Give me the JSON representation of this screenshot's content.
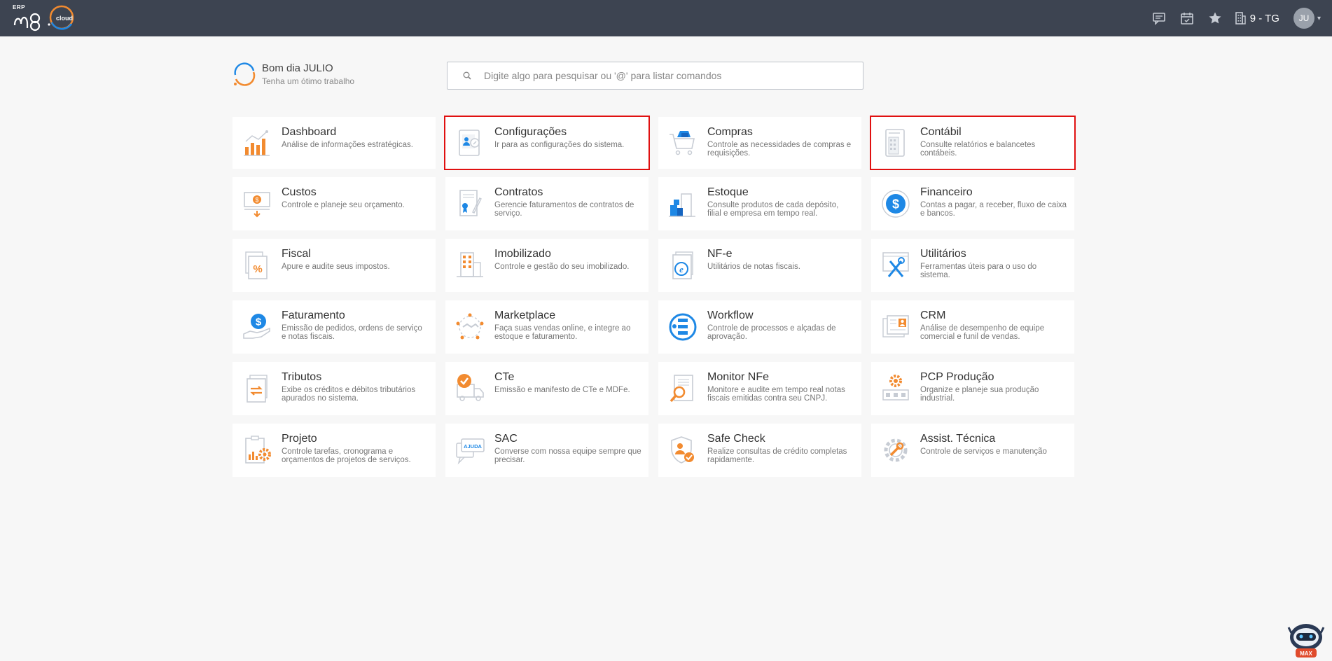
{
  "header": {
    "logo_tag": "ERP",
    "logo_brand": "m8",
    "logo_suffix": "cloud",
    "company": "9 - TG",
    "user_initials": "JU",
    "icons": [
      "chat-icon",
      "calendar-icon",
      "star-icon",
      "building-icon"
    ]
  },
  "greeting": {
    "title": "Bom dia JULIO",
    "subtitle": "Tenha um ótimo trabalho"
  },
  "search": {
    "placeholder": "Digite algo para pesquisar ou '@' para listar comandos"
  },
  "modules": [
    {
      "title": "Dashboard",
      "desc": "Análise de informações estratégicas.",
      "icon": "dashboard-icon"
    },
    {
      "title": "Configurações",
      "desc": "Ir para as configurações do sistema.",
      "icon": "settings-icon",
      "highlighted": true
    },
    {
      "title": "Compras",
      "desc": "Controle as necessidades de compras e requisições.",
      "icon": "cart-icon"
    },
    {
      "title": "Contábil",
      "desc": "Consulte relatórios e balancetes contábeis.",
      "icon": "calculator-icon",
      "highlighted": true
    },
    {
      "title": "Custos",
      "desc": "Controle e planeje seu orçamento.",
      "icon": "money-icon"
    },
    {
      "title": "Contratos",
      "desc": "Gerencie faturamentos de contratos de serviço.",
      "icon": "contract-icon"
    },
    {
      "title": "Estoque",
      "desc": "Consulte produtos de cada depósito, filial e empresa em tempo real.",
      "icon": "stock-icon"
    },
    {
      "title": "Financeiro",
      "desc": "Contas a pagar, a receber, fluxo de caixa e bancos.",
      "icon": "dollar-circle-icon"
    },
    {
      "title": "Fiscal",
      "desc": "Apure e audite seus impostos.",
      "icon": "percent-doc-icon"
    },
    {
      "title": "Imobilizado",
      "desc": "Controle e gestão do seu imobilizado.",
      "icon": "building-asset-icon"
    },
    {
      "title": "NF-e",
      "desc": "Utilitários de notas fiscais.",
      "icon": "nfe-icon"
    },
    {
      "title": "Utilitários",
      "desc": "Ferramentas úteis para o uso do sistema.",
      "icon": "tools-icon"
    },
    {
      "title": "Faturamento",
      "desc": "Emissão de pedidos, ordens de serviço e notas fiscais.",
      "icon": "billing-icon"
    },
    {
      "title": "Marketplace",
      "desc": "Faça suas vendas online, e integre ao estoque e faturamento.",
      "icon": "handshake-icon"
    },
    {
      "title": "Workflow",
      "desc": "Controle de processos e alçadas de aprovação.",
      "icon": "workflow-icon"
    },
    {
      "title": "CRM",
      "desc": "Análise de desempenho de equipe comercial e funil de vendas.",
      "icon": "crm-icon"
    },
    {
      "title": "Tributos",
      "desc": "Exibe os créditos e débitos tributários apurados no sistema.",
      "icon": "tax-icon"
    },
    {
      "title": "CTe",
      "desc": "Emissão e manifesto de CTe e MDFe.",
      "icon": "truck-icon"
    },
    {
      "title": "Monitor NFe",
      "desc": "Monitore e audite em tempo real notas fiscais emitidas contra seu CNPJ.",
      "icon": "magnifier-doc-icon"
    },
    {
      "title": "PCP Produção",
      "desc": "Organize e planeje sua produção industrial.",
      "icon": "production-icon"
    },
    {
      "title": "Projeto",
      "desc": "Controle tarefas, cronograma e orçamentos de projetos de serviços.",
      "icon": "project-icon"
    },
    {
      "title": "SAC",
      "desc": "Converse com nossa equipe sempre que precisar.",
      "icon": "help-chat-icon",
      "badge": "AJUDA"
    },
    {
      "title": "Safe Check",
      "desc": "Realize consultas de crédito completas rapidamente.",
      "icon": "shield-check-icon"
    },
    {
      "title": "Assist. Técnica",
      "desc": "Controle de serviços e manutenção",
      "icon": "gear-wrench-icon"
    }
  ],
  "assistant": {
    "label": "MAX",
    "icon": "robot-assistant-icon"
  },
  "colors": {
    "topbar": "#3d4451",
    "accent_orange": "#f28b30",
    "accent_blue": "#1e88e5",
    "highlight": "#e01010"
  }
}
